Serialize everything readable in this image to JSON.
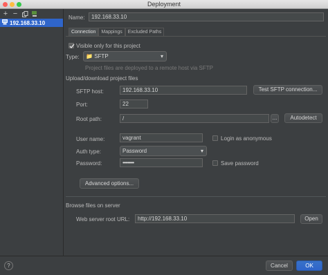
{
  "window": {
    "title": "Deployment"
  },
  "colors": {
    "accent": "#2f65ca",
    "panel": "#3c3f41",
    "field": "#45494a"
  },
  "sidebar": {
    "toolbar": [
      "add-icon",
      "remove-icon",
      "copy-icon",
      "default-server-icon"
    ],
    "items": [
      {
        "label": "192.168.33.10",
        "icon": "sftp-server-icon",
        "selected": true
      }
    ]
  },
  "name": {
    "label": "Name:",
    "value": "192.168.33.10"
  },
  "tabs": [
    {
      "label": "Connection",
      "active": true
    },
    {
      "label": "Mappings",
      "active": false
    },
    {
      "label": "Excluded Paths",
      "active": false
    }
  ],
  "connection": {
    "visible_only": {
      "label": "Visible only for this project",
      "checked": true
    },
    "type": {
      "label": "Type:",
      "value": "SFTP",
      "hint": "Project files are deployed to a remote host via SFTP"
    },
    "upload_section": "Upload/download project files",
    "sftp_host": {
      "label": "SFTP host:",
      "value": "192.168.33.10",
      "test_button": "Test SFTP connection..."
    },
    "port": {
      "label": "Port:",
      "value": "22"
    },
    "root_path": {
      "label": "Root path:",
      "value": "/",
      "browse": "...",
      "autodetect": "Autodetect"
    },
    "user_name": {
      "label": "User name:",
      "value": "vagrant"
    },
    "login_anon": {
      "label": "Login as anonymous",
      "checked": false
    },
    "auth_type": {
      "label": "Auth type:",
      "value": "Password"
    },
    "password": {
      "label": "Password:",
      "value": "•••••••••"
    },
    "save_password": {
      "label": "Save password",
      "checked": false
    },
    "advanced": "Advanced options...",
    "browse_section": "Browse files on server",
    "web_root": {
      "label": "Web server root URL:",
      "value": "http://192.168.33.10",
      "open": "Open"
    }
  },
  "footer": {
    "help": "?",
    "cancel": "Cancel",
    "ok": "OK"
  }
}
